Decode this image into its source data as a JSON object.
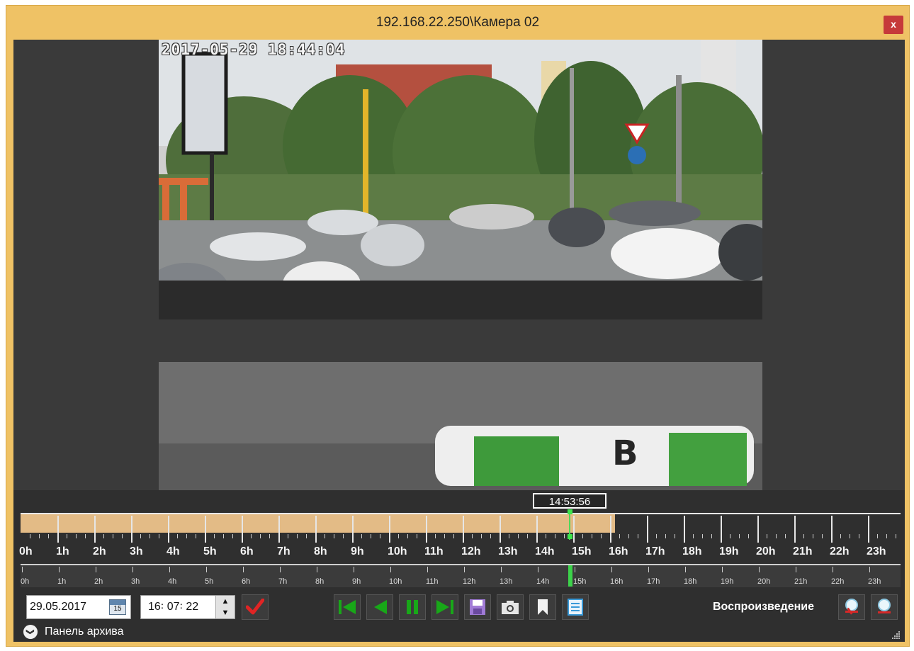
{
  "window": {
    "title": "192.168.22.250\\Камера 02",
    "close_label": "x"
  },
  "video": {
    "osd_timestamp": "2017-05-29 18:44:04"
  },
  "timeline": {
    "cursor_time": "14:53:56",
    "recorded_until_fraction": 0.672,
    "cursor_fraction": 0.621,
    "hours": [
      "0h",
      "1h",
      "2h",
      "3h",
      "4h",
      "5h",
      "6h",
      "7h",
      "8h",
      "9h",
      "10h",
      "11h",
      "12h",
      "13h",
      "14h",
      "15h",
      "16h",
      "17h",
      "18h",
      "19h",
      "20h",
      "21h",
      "22h",
      "23h"
    ]
  },
  "controls": {
    "date_value": "29.05.2017",
    "calendar_day": "15",
    "time_value": "16꞉ 07꞉ 22",
    "spin_up": "▲",
    "spin_down": "▼",
    "mode_label": "Воспроизведение",
    "colors": {
      "play_green": "#18a818",
      "confirm_red": "#e02424",
      "save_purple": "#a07bd6"
    }
  },
  "archive_panel": {
    "label": "Панель архива",
    "chevron": "❯"
  }
}
